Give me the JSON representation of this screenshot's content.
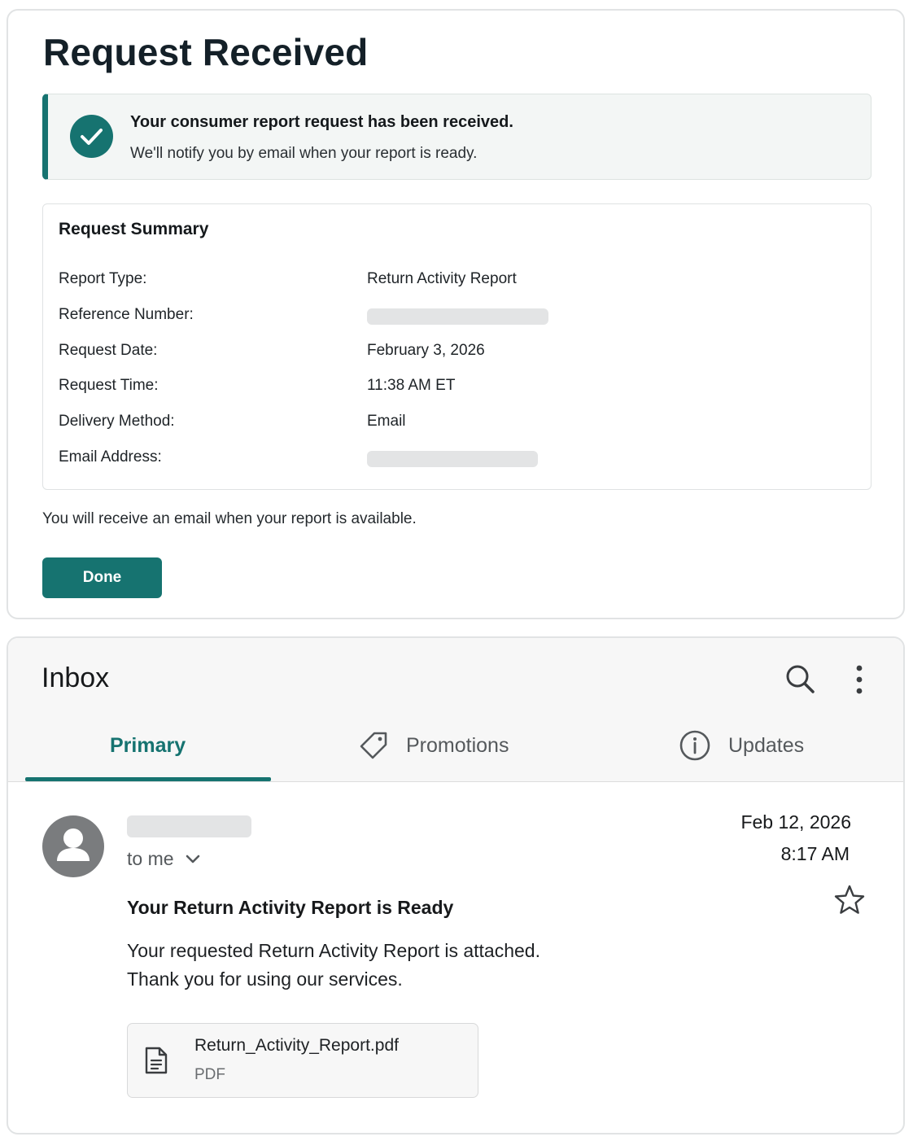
{
  "confirmation": {
    "title": "Request Received",
    "alert": {
      "title": "Your consumer report request has been received.",
      "message": "We'll notify you by email when your report is ready."
    },
    "summary": {
      "title": "Request Summary",
      "rows": [
        {
          "label": "Report Type:",
          "value": "Return Activity Report"
        },
        {
          "label": "Reference Number:",
          "value": null
        },
        {
          "label": "Request Date:",
          "value": "February 3, 2026"
        },
        {
          "label": "Request Time:",
          "value": "11:38 AM ET"
        },
        {
          "label": "Delivery Method:",
          "value": "Email"
        },
        {
          "label": "Email Address:",
          "value": null
        }
      ]
    },
    "footer_note": "You will receive an email when your report is available.",
    "done_label": "Done"
  },
  "inbox": {
    "title": "Inbox",
    "tabs": [
      {
        "label": "Primary",
        "icon": "none",
        "selected": true
      },
      {
        "label": "Promotions",
        "icon": "tag-icon",
        "selected": false
      },
      {
        "label": "Updates",
        "icon": "info-icon",
        "selected": false
      }
    ],
    "message": {
      "recipient": "to me",
      "date": "Feb 12, 2026",
      "time": "8:17 AM",
      "subject": "Your Return Activity Report is Ready",
      "body_lines": [
        "Your requested Return Activity Report is attached.",
        "Thank you for using our services."
      ],
      "attachment": {
        "filename": "Return_Activity_Report.pdf",
        "type": "PDF"
      }
    }
  },
  "colors": {
    "accent": "#167370",
    "alert_bg": "#f3f6f5",
    "redacted": "#e3e4e5"
  }
}
